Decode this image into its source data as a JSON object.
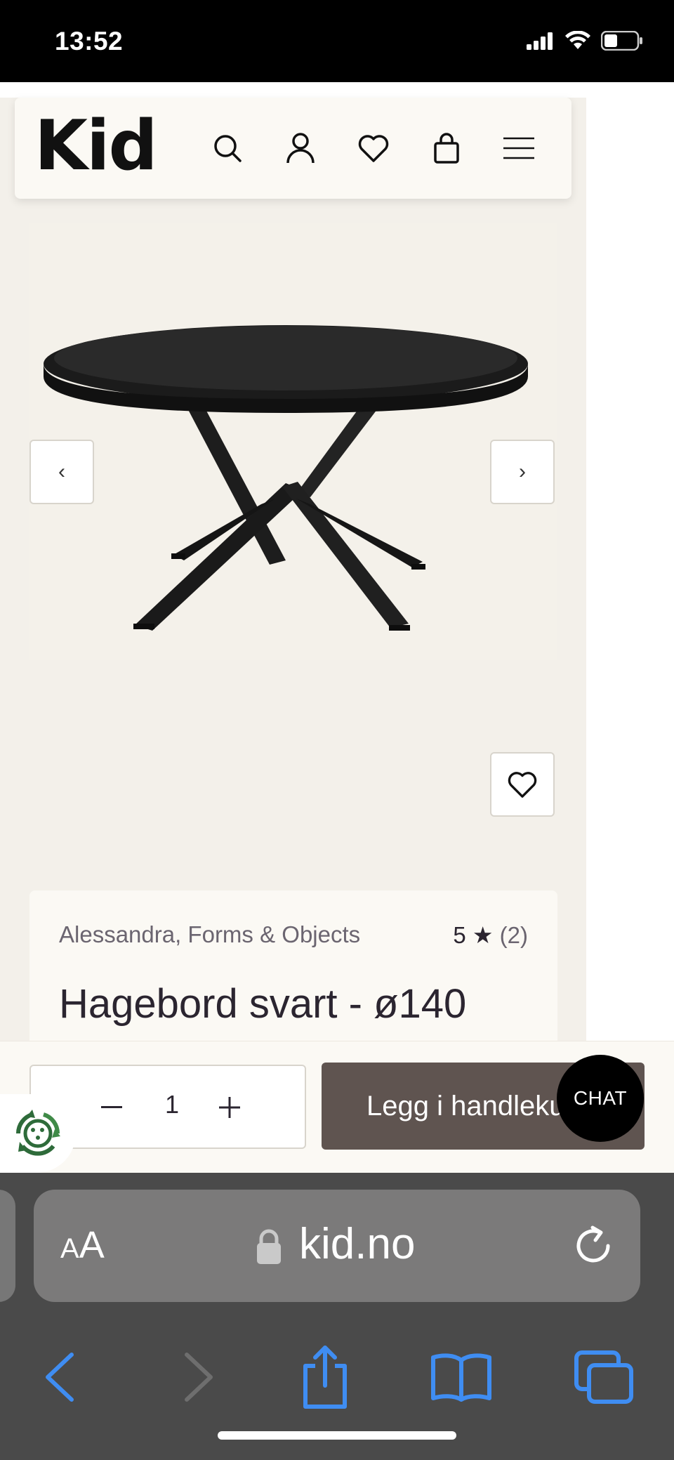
{
  "status_bar": {
    "time": "13:52"
  },
  "header": {
    "logo": "Kid",
    "icons": [
      "search-icon",
      "user-icon",
      "heart-icon",
      "bag-icon",
      "menu-icon"
    ]
  },
  "gallery": {
    "prev_label": "‹",
    "next_label": "›"
  },
  "product": {
    "brand": "Alessandra, Forms & Objects",
    "rating_value": "5 ★",
    "rating_count": "(2)",
    "title": "Hagebord svart - ø140"
  },
  "buy_bar": {
    "quantity": "1",
    "add_label": "Legg i handlekurv",
    "chat_label": "CHAT"
  },
  "browser": {
    "aa_large": "A",
    "aa_small": "A",
    "url": "kid.no"
  },
  "colors": {
    "page_bg": "#f3f0ea",
    "card_bg": "#fbf9f4",
    "add_button": "#5f5450",
    "safari_blue": "#3f8df2"
  }
}
